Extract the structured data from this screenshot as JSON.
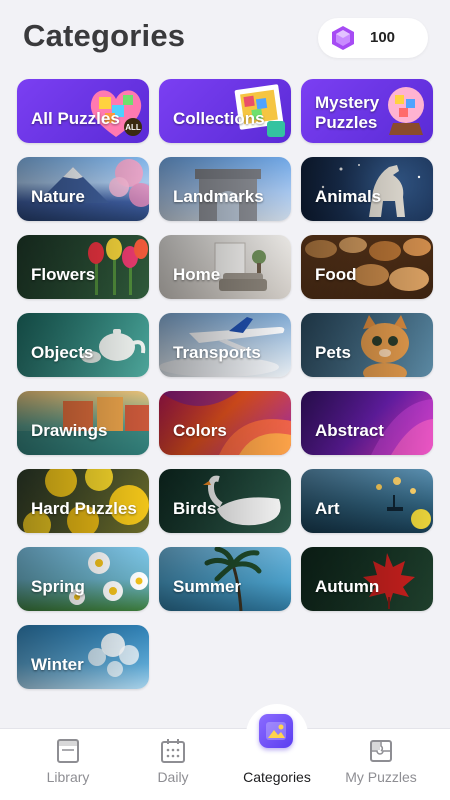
{
  "header": {
    "title": "Categories",
    "gem_count": "100"
  },
  "tiles": [
    {
      "label": "All Puzzles",
      "icon": "heart-puzzle"
    },
    {
      "label": "Collections",
      "icon": "stamp-puzzle"
    },
    {
      "label": "Mystery Puzzles",
      "icon": "crystal-ball-puzzle"
    },
    {
      "label": "Nature",
      "icon": "mountain-photo"
    },
    {
      "label": "Landmarks",
      "icon": "arch-photo"
    },
    {
      "label": "Animals",
      "icon": "horse-photo"
    },
    {
      "label": "Flowers",
      "icon": "tulips-photo"
    },
    {
      "label": "Home",
      "icon": "room-photo"
    },
    {
      "label": "Food",
      "icon": "bread-photo"
    },
    {
      "label": "Objects",
      "icon": "teapot-photo"
    },
    {
      "label": "Transports",
      "icon": "airplane-photo"
    },
    {
      "label": "Pets",
      "icon": "kitten-photo"
    },
    {
      "label": "Drawings",
      "icon": "painting-photo"
    },
    {
      "label": "Colors",
      "icon": "color-waves-photo"
    },
    {
      "label": "Abstract",
      "icon": "abstract-waves-photo"
    },
    {
      "label": "Hard Puzzles",
      "icon": "lemons-photo"
    },
    {
      "label": "Birds",
      "icon": "swan-photo"
    },
    {
      "label": "Art",
      "icon": "lanterns-photo"
    },
    {
      "label": "Spring",
      "icon": "daisies-photo"
    },
    {
      "label": "Summer",
      "icon": "palm-photo"
    },
    {
      "label": "Autumn",
      "icon": "maple-leaf-photo"
    },
    {
      "label": "Winter",
      "icon": "frost-photo"
    }
  ],
  "tabbar": {
    "tabs": [
      {
        "label": "Library",
        "icon": "library-icon"
      },
      {
        "label": "Daily",
        "icon": "calendar-icon"
      },
      {
        "label": "Categories",
        "icon": "categories-icon"
      },
      {
        "label": "My Puzzles",
        "icon": "puzzle-icon"
      }
    ],
    "active": "Categories"
  },
  "colors": {
    "accent": "#6a4cf5",
    "gem": "#a64bf4",
    "background": "#f2f2f6"
  }
}
